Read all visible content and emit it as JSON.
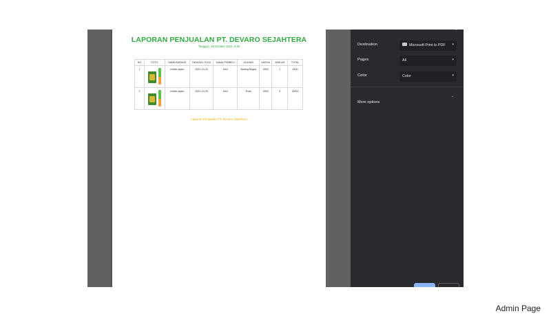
{
  "report": {
    "title": "LAPORAN PENJUALAN PT. DEVARO SEJAHTERA",
    "date": "Tanggal : 26 October 2022, 6:35",
    "columns": [
      "NO",
      "FOTO",
      "NAMA BARANG",
      "TANGGAL SOLD",
      "NAMA PEMBELI",
      "ULASAN",
      "HARGA",
      "JUMLAH",
      "TOTAL"
    ],
    "rows": [
      {
        "no": "1",
        "product": "chitato ayam",
        "date": "2022-10-20",
        "buyer": "Devi",
        "review": "Barang Bagus",
        "price": "4500",
        "qty": "1",
        "total": "4500"
      },
      {
        "no": "2",
        "product": "chitato ayam",
        "date": "2022-10-25",
        "buyer": "Devi",
        "review": "Enak",
        "price": "4500",
        "qty": "4",
        "total": "18000"
      }
    ],
    "footer": "Laporan Penjualan PT. Devaro Sejahtera"
  },
  "print_panel": {
    "destination_label": "Destination",
    "destination_value": "Microsoft Print to PDF",
    "pages_label": "Pages",
    "pages_value": "All",
    "color_label": "Color",
    "color_value": "Color",
    "more_options_label": "More options"
  },
  "page_label": "Admin Page",
  "colors": {
    "title_green": "#2eaa3e",
    "footer_yellow": "#f5b400",
    "panel_bg": "#292a2d",
    "print_blue": "#8ab4f8"
  },
  "icons": {
    "printer": "printer-icon",
    "chevron": "chevron-down-icon"
  }
}
